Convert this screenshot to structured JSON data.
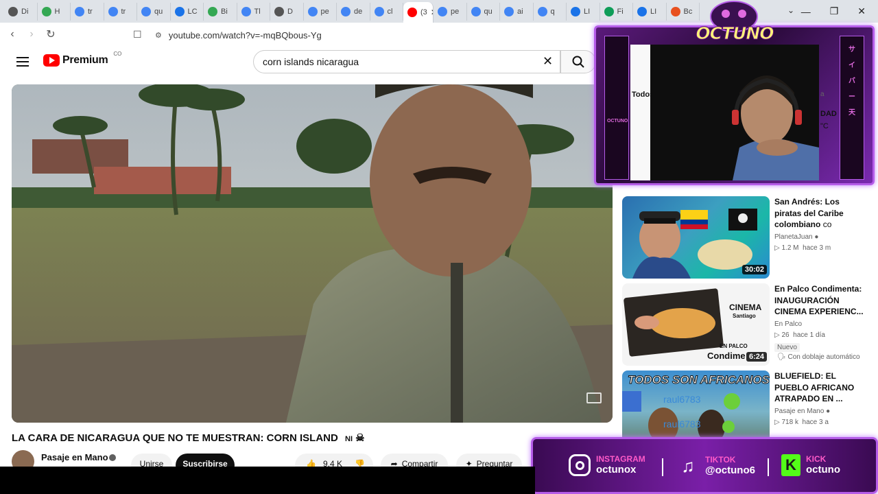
{
  "browser": {
    "tabs": [
      {
        "label": "Di",
        "icon": "chatgpt-icon",
        "color": "#555555"
      },
      {
        "label": "H",
        "icon": "maps-icon",
        "color": "#34a853"
      },
      {
        "label": "tr",
        "icon": "google-icon",
        "color": "#4285f4"
      },
      {
        "label": "tr",
        "icon": "google-icon",
        "color": "#4285f4"
      },
      {
        "label": "qu",
        "icon": "google-icon",
        "color": "#4285f4"
      },
      {
        "label": "LC",
        "icon": "translate-icon",
        "color": "#1a73e8"
      },
      {
        "label": "Bi",
        "icon": "maps-icon",
        "color": "#34a853"
      },
      {
        "label": "Tl",
        "icon": "google-icon",
        "color": "#4285f4"
      },
      {
        "label": "D",
        "icon": "chatgpt-icon",
        "color": "#555555"
      },
      {
        "label": "pe",
        "icon": "google-icon",
        "color": "#4285f4"
      },
      {
        "label": "de",
        "icon": "google-icon",
        "color": "#4285f4"
      },
      {
        "label": "cl",
        "icon": "google-icon",
        "color": "#4285f4"
      },
      {
        "label": "(3",
        "icon": "youtube-icon",
        "color": "#ff0000",
        "active": true
      },
      {
        "label": "pe",
        "icon": "google-icon",
        "color": "#4285f4"
      },
      {
        "label": "qu",
        "icon": "google-icon",
        "color": "#4285f4"
      },
      {
        "label": "ai",
        "icon": "google-icon",
        "color": "#4285f4"
      },
      {
        "label": "q",
        "icon": "google-icon",
        "color": "#4285f4"
      },
      {
        "label": "LI",
        "icon": "translate-icon",
        "color": "#1a73e8"
      },
      {
        "label": "Fi",
        "icon": "drive-icon",
        "color": "#0f9d58"
      },
      {
        "label": "LI",
        "icon": "translate-icon",
        "color": "#1a73e8"
      },
      {
        "label": "Bc",
        "icon": "k-icon",
        "color": "#e8501e"
      }
    ],
    "url": "youtube.com/watch?v=-mqBQbous-Yg"
  },
  "youtube": {
    "brand": "Premium",
    "country": "CO",
    "search_query": "corn islands nicaragua"
  },
  "video": {
    "title": "LA CARA DE NICARAGUA QUE NO TE MUESTRAN: CORN ISLAND",
    "title_tag": "NI",
    "channel": "Pasaje en Mano",
    "join_label": "Unirse",
    "subscribe_label": "Suscribirse",
    "likes": "9,4 K",
    "share_label": "Compartir",
    "ask_label": "Preguntar"
  },
  "recommendations": [
    {
      "title": "San Andrés: Los piratas del Caribe colombiano",
      "title_suffix": "co",
      "channel": "PlanetaJuan",
      "views": "1.2 M",
      "age": "hace 3 m",
      "duration": "30:02"
    },
    {
      "title": "En Palco Condimenta: INAUGURACIÓN CINEMA EXPERIENC...",
      "channel": "En Palco",
      "views": "26",
      "age": "hace 1 día",
      "badge": "Nuevo",
      "dub": "Con doblaje automático",
      "duration": "6:24",
      "thumb_text1": "CINEMA",
      "thumb_text2": "Santiago",
      "thumb_text3": "EN PALCO",
      "thumb_text4": "Condime"
    },
    {
      "title": "BLUEFIELD: EL PUEBLO AFRICANO ATRAPADO EN ...",
      "channel": "Pasaje en Mano",
      "views": "718 k",
      "age": "hace 3 a",
      "thumb_text": "TODOS SON AFRICANOS!",
      "chat1": "raul6783",
      "chat2": "raul6783"
    }
  ],
  "stream_overlay": {
    "brand": "OCTUNO",
    "todos": "Todos",
    "side_text": "OCTUNO",
    "right_glyphs": [
      "サ",
      "イ",
      "バ",
      "ー",
      "天"
    ],
    "peek_text": [
      "DAD",
      "\"C",
      "a"
    ],
    "social": [
      {
        "network": "INSTAGRAM",
        "handle": "octunox",
        "color": "#ff5ac8",
        "icon": "instagram-icon"
      },
      {
        "network": "TIKTOK",
        "handle": "@octuno6",
        "color": "#ff5ac8",
        "icon": "tiktok-icon"
      },
      {
        "network": "KICK",
        "handle": "octuno",
        "color": "#ff5ac8",
        "icon": "kick-icon"
      }
    ]
  }
}
